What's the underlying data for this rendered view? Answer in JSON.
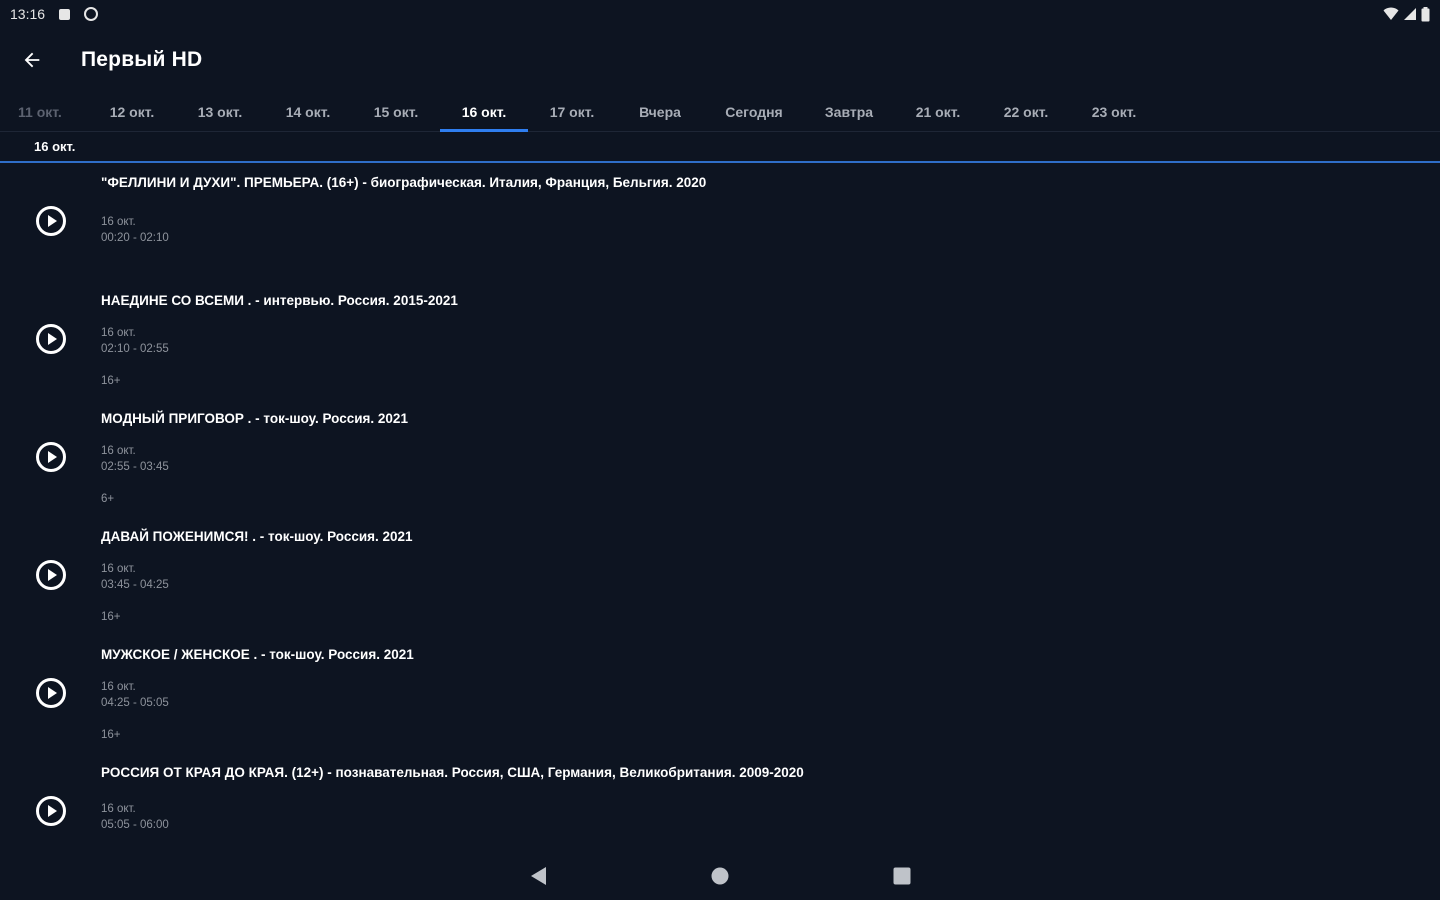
{
  "status_bar": {
    "time": "13:16",
    "icons": [
      "notification-square-icon",
      "sync-circle-icon",
      "wifi-icon",
      "signal-icon",
      "battery-icon"
    ]
  },
  "app_bar": {
    "back_icon": "arrow-back-icon",
    "title": "Первый HD"
  },
  "tabs": [
    {
      "label": "11 окт.",
      "state": "dim"
    },
    {
      "label": "12 окт.",
      "state": "normal"
    },
    {
      "label": "13 окт.",
      "state": "normal"
    },
    {
      "label": "14 окт.",
      "state": "normal"
    },
    {
      "label": "15 окт.",
      "state": "normal"
    },
    {
      "label": "16 окт.",
      "state": "active"
    },
    {
      "label": "17 окт.",
      "state": "normal"
    },
    {
      "label": "Вчера",
      "state": "normal"
    },
    {
      "label": "Сегодня",
      "state": "normal"
    },
    {
      "label": "Завтра",
      "state": "normal"
    },
    {
      "label": "21 окт.",
      "state": "normal"
    },
    {
      "label": "22 окт.",
      "state": "normal"
    },
    {
      "label": "23 окт.",
      "state": "normal"
    }
  ],
  "date_header": "16 окт.",
  "programs": [
    {
      "title": "\"ФЕЛЛИНИ И ДУХИ\". ПРЕМЬЕРА. (16+)  - биографическая. Италия, Франция, Бельгия. 2020",
      "date": "16 окт.",
      "time": "00:20 - 02:10",
      "age": ""
    },
    {
      "title": "НАЕДИНЕ СО ВСЕМИ . - интервью. Россия. 2015-2021",
      "date": "16 окт.",
      "time": "02:10 - 02:55",
      "age": "16+"
    },
    {
      "title": "МОДНЫЙ ПРИГОВОР . - ток-шоу. Россия. 2021",
      "date": "16 окт.",
      "time": "02:55 - 03:45",
      "age": "6+"
    },
    {
      "title": "ДАВАЙ ПОЖЕНИМСЯ! . - ток-шоу. Россия. 2021",
      "date": "16 окт.",
      "time": "03:45 - 04:25",
      "age": "16+"
    },
    {
      "title": "МУЖСКОЕ / ЖЕНСКОЕ . - ток-шоу. Россия. 2021",
      "date": "16 окт.",
      "time": "04:25 - 05:05",
      "age": "16+"
    },
    {
      "title": "РОССИЯ ОТ КРАЯ ДО КРАЯ. (12+)  - познавательная. Россия, США, Германия, Великобритания. 2009-2020",
      "date": "16 окт.",
      "time": "05:05 - 06:00",
      "age": ""
    }
  ],
  "nav_bar": {
    "back": "nav-back-icon",
    "home": "nav-home-icon",
    "recents": "nav-recents-icon"
  },
  "colors": {
    "background": "#0d1421",
    "accent": "#2f7ef0",
    "secondary_text": "#8e939c"
  }
}
